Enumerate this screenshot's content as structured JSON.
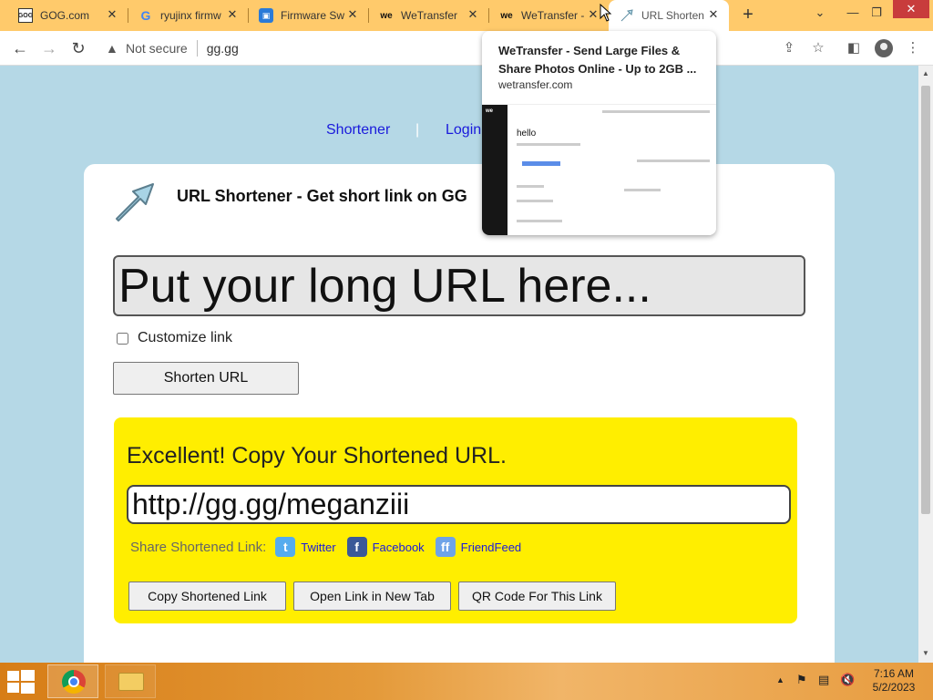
{
  "tabs": [
    {
      "favicon": "gog",
      "title": "GOG.com"
    },
    {
      "favicon": "google",
      "title": "ryujinx firmw"
    },
    {
      "favicon": "firmware",
      "title": "Firmware Sw"
    },
    {
      "favicon": "wetransfer",
      "title": "WeTransfer"
    },
    {
      "favicon": "wetransfer",
      "title": "WeTransfer -"
    },
    {
      "favicon": "url-shortener",
      "title": "URL Shorten"
    }
  ],
  "toolbar": {
    "security_label": "Not secure",
    "url": "gg.gg"
  },
  "tab_preview": {
    "title": "WeTransfer - Send Large Files & Share Photos Online - Up to 2GB ...",
    "domain": "wetransfer.com",
    "thumb_heading": "hello"
  },
  "page": {
    "nav": {
      "shortener": "Shortener",
      "separator": "|",
      "login": "Login"
    },
    "heading": "URL Shortener - Get short link on GG",
    "long_url_placeholder": "Put your long URL here...",
    "customize_label": "Customize link",
    "customize_checked": false,
    "shorten_button": "Shorten URL",
    "result": {
      "message": "Excellent! Copy Your Shortened URL.",
      "short_url": "http://gg.gg/meganziii",
      "share_label": "Share Shortened Link:",
      "share_links": [
        {
          "label": "Twitter",
          "icon": "twitter-icon",
          "color": "#55acee"
        },
        {
          "label": "Facebook",
          "icon": "facebook-icon",
          "color": "#3b5998"
        },
        {
          "label": "FriendFeed",
          "icon": "friendfeed-icon",
          "color": "#6ea3e8"
        }
      ],
      "buttons": {
        "copy": "Copy Shortened Link",
        "open": "Open Link in New Tab",
        "qr": "QR Code For This Link"
      }
    }
  },
  "taskbar": {
    "time": "7:16 AM",
    "date": "5/2/2023"
  },
  "colors": {
    "tabstrip": "#ffca6b",
    "page_bg": "#b5d8e6",
    "result_bg": "#ffee00",
    "link": "#1a1adc"
  }
}
